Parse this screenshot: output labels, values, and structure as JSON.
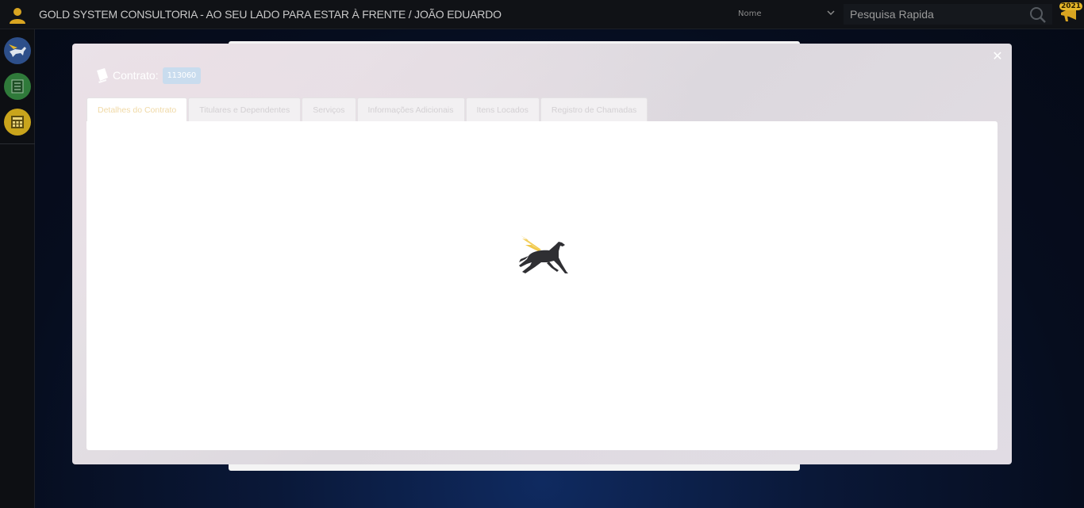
{
  "app": {
    "title": "GOLD SYSTEM CONSULTORIA - AO SEU LADO PARA ESTAR À FRENTE / JOÃO EDUARDO"
  },
  "search": {
    "select_value": "Nome",
    "placeholder": "Pesquisa Rapida"
  },
  "notification": {
    "count": "2021"
  },
  "sidebar": {
    "items": [
      {
        "icon": "pegasus-logo-icon",
        "color": "#2d4f8a"
      },
      {
        "icon": "list-icon",
        "color": "#2f7a3a"
      },
      {
        "icon": "calculator-icon",
        "color": "#c9a41c"
      }
    ]
  },
  "modal": {
    "label": "Contrato:",
    "contract_number": "113060",
    "tabs": [
      {
        "label": "Detalhes do Contrato",
        "active": true
      },
      {
        "label": "Titulares e Dependentes",
        "active": false
      },
      {
        "label": "Serviços",
        "active": false
      },
      {
        "label": "Informações Adicionais",
        "active": false
      },
      {
        "label": "Itens Locados",
        "active": false
      },
      {
        "label": "Registro de Chamadas",
        "active": false
      }
    ],
    "loading_icon": "pegasus-loading-icon"
  },
  "colors": {
    "accent_gold": "#e5b72a",
    "active_tab_text": "#f0d9a6",
    "badge_bg": "#c9dcee"
  }
}
